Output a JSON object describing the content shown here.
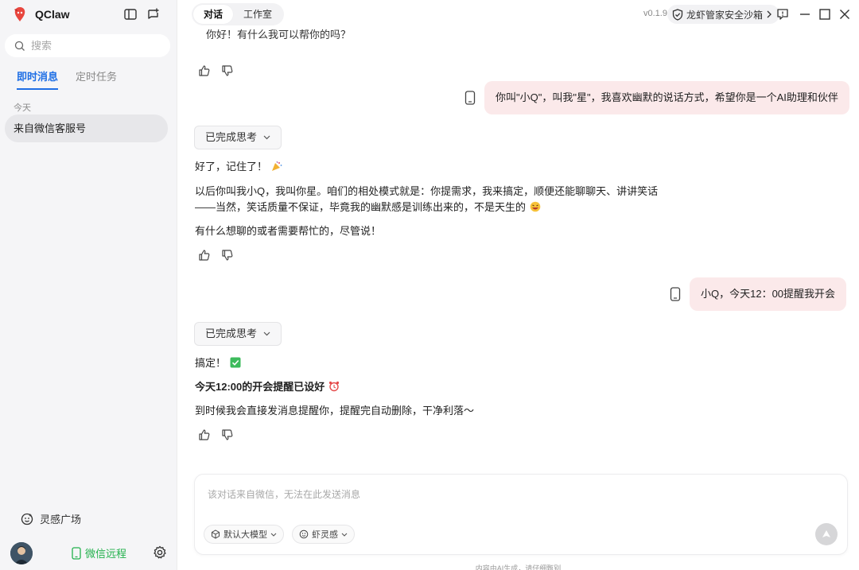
{
  "app": {
    "name": "QClaw",
    "version": "v0.1.9"
  },
  "sidebar": {
    "search_placeholder": "搜索",
    "tabs": [
      {
        "label": "即时消息",
        "active": true
      },
      {
        "label": "定时任务",
        "active": false
      }
    ],
    "section_label": "今天",
    "conversations": [
      {
        "title": "来自微信客服号",
        "selected": true
      }
    ],
    "inspire_label": "灵感广场",
    "wechat_remote_label": "微信远程"
  },
  "header": {
    "tabs": [
      {
        "label": "对话",
        "active": true
      },
      {
        "label": "工作室",
        "active": false
      }
    ],
    "sandbox_label": "龙虾管家安全沙箱"
  },
  "chat": {
    "clipped_text": "你好！有什么我可以帮你的吗？",
    "messages": [
      {
        "role": "user",
        "text": "你叫\"小Q\"，叫我\"星\"，我喜欢幽默的说话方式，希望你是一个AI助理和伙伴"
      },
      {
        "role": "assistant",
        "think_label": "已完成思考",
        "lines": [
          "好了，记住了！",
          "以后你叫我小Q，我叫你星。咱们的相处模式就是：你提需求，我来搞定，顺便还能聊聊天、讲讲笑话",
          "——当然，笑话质量不保证，毕竟我的幽默感是训练出来的，不是天生的",
          "有什么想聊的或者需要帮忙的，尽管说！"
        ]
      },
      {
        "role": "user",
        "text": "小Q，今天12：00提醒我开会"
      },
      {
        "role": "assistant",
        "think_label": "已完成思考",
        "lines": [
          "搞定！",
          "今天12:00的开会提醒已设好",
          "到时候我会直接发消息提醒你，提醒完自动删除，干净利落～"
        ]
      }
    ]
  },
  "composer": {
    "placeholder": "该对话来自微信，无法在此发送消息",
    "model_label": "默认大模型",
    "inspire_label": "虾灵感"
  },
  "footer_note": "内容由AI生成，请仔细甄别",
  "colors": {
    "accent": "#1f6fe5",
    "user_bubble": "#fbe9ea",
    "wechat_green": "#22b14c",
    "brand_red": "#e8463e"
  }
}
